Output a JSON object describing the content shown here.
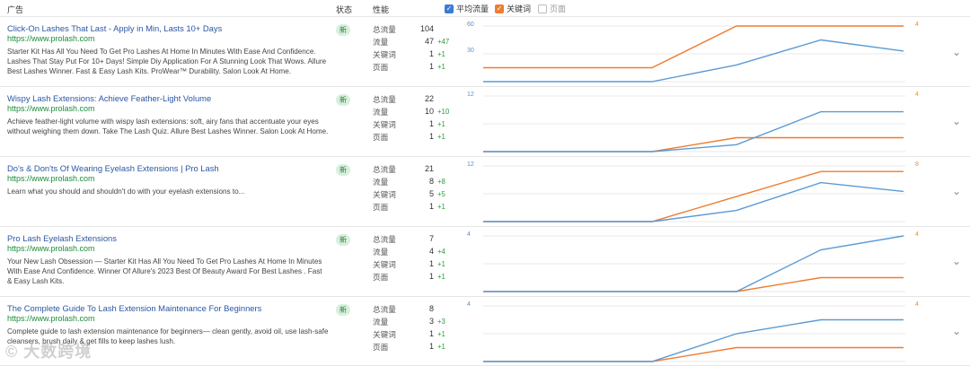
{
  "header": {
    "ad": "广告",
    "status": "状态",
    "perf": "性能",
    "legend_avg": "平均流量",
    "legend_kw": "关键词",
    "legend_page": "页面"
  },
  "colors": {
    "avg": "#5b9bd5",
    "kw": "#ed7d31",
    "link": "#2a57a4",
    "url": "#1a8d3a",
    "delta": "#2a9d3a"
  },
  "labels": {
    "total": "总流量",
    "traffic": "流量",
    "keywords": "关键词",
    "pages": "页面"
  },
  "watermark": "© 大数跨境",
  "rows": [
    {
      "title": "Click-On Lashes That Last - Apply in Min, Lasts 10+ Days",
      "url": "https://www.prolash.com",
      "desc": "Starter Kit Has All You Need To Get Pro Lashes At Home In Minutes With Ease And Confidence. Lashes That Stay Put For 10+ Days! Simple Diy Application For A Stunning Look That Wows. Allure Best Lashes Winner. Fast & Easy Lash Kits. ProWear™ Durability. Salon Look At Home.",
      "status": "新",
      "total": "104",
      "traffic": "47",
      "traffic_delta": "+47",
      "keywords": "1",
      "keywords_delta": "+1",
      "pages": "1",
      "pages_delta": "+1",
      "ymax_left": "60",
      "ymid_left": "30",
      "ymax_right": "4",
      "avg": [
        0,
        0,
        0,
        0,
        18,
        45,
        33
      ],
      "kw": [
        1,
        1,
        1,
        1,
        4,
        4,
        4
      ],
      "lmax": 60,
      "rmax": 4
    },
    {
      "title": "Wispy Lash Extensions: Achieve Feather-Light Volume",
      "url": "https://www.prolash.com",
      "desc": "Achieve feather-light volume with wispy lash extensions: soft, airy fans that accentuate your eyes without weighing them down. Take The Lash Quiz. Allure Best Lashes Winner. Salon Look At Home.",
      "status": "新",
      "total": "22",
      "traffic": "10",
      "traffic_delta": "+10",
      "keywords": "1",
      "keywords_delta": "+1",
      "pages": "1",
      "pages_delta": "+1",
      "ymax_left": "12",
      "ymid_left": "",
      "ymax_right": "4",
      "avg": [
        0,
        0,
        0,
        0,
        1.5,
        8.6,
        8.6
      ],
      "kw": [
        0,
        0,
        0,
        0,
        1,
        1,
        1
      ],
      "lmax": 12,
      "rmax": 4
    },
    {
      "title": "Do's & Don'ts Of Wearing Eyelash Extensions | Pro Lash",
      "url": "https://www.prolash.com",
      "desc": "Learn what you should and shouldn't do with your eyelash extensions to...",
      "status": "新",
      "total": "21",
      "traffic": "8",
      "traffic_delta": "+8",
      "keywords": "5",
      "keywords_delta": "+5",
      "pages": "1",
      "pages_delta": "+1",
      "ymax_left": "12",
      "ymid_left": "",
      "ymax_right": "8",
      "avg": [
        0,
        0,
        0,
        0,
        2.4,
        8.4,
        6.5
      ],
      "kw": [
        0,
        0,
        0,
        0,
        3.6,
        7.2,
        7.2
      ],
      "lmax": 12,
      "rmax": 8
    },
    {
      "title": "Pro Lash Eyelash Extensions",
      "url": "https://www.prolash.com",
      "desc": "Your New Lash Obsession — Starter Kit Has All You Need To Get Pro Lashes At Home In Minutes With Ease And Confidence. Winner Of Allure's 2023 Best Of Beauty Award For Best Lashes . Fast & Easy Lash Kits.",
      "status": "新",
      "total": "7",
      "traffic": "4",
      "traffic_delta": "+4",
      "keywords": "1",
      "keywords_delta": "+1",
      "pages": "1",
      "pages_delta": "+1",
      "ymax_left": "4",
      "ymid_left": "",
      "ymax_right": "4",
      "avg": [
        0,
        0,
        0,
        0,
        0,
        3,
        4
      ],
      "kw": [
        0,
        0,
        0,
        0,
        0,
        1,
        1
      ],
      "lmax": 4,
      "rmax": 4
    },
    {
      "title": "The Complete Guide To Lash Extension Maintenance For Beginners",
      "url": "https://www.prolash.com",
      "desc": "Complete guide to lash extension maintenance for beginners— clean gently, avoid oil, use lash-safe cleansers, brush daily & get fills to keep lashes lush.",
      "status": "新",
      "total": "8",
      "traffic": "3",
      "traffic_delta": "+3",
      "keywords": "1",
      "keywords_delta": "+1",
      "pages": "1",
      "pages_delta": "+1",
      "ymax_left": "4",
      "ymid_left": "",
      "ymax_right": "4",
      "avg": [
        0,
        0,
        0,
        0,
        2,
        3,
        3
      ],
      "kw": [
        0,
        0,
        0,
        0,
        1,
        1,
        1
      ],
      "lmax": 4,
      "rmax": 4
    }
  ]
}
